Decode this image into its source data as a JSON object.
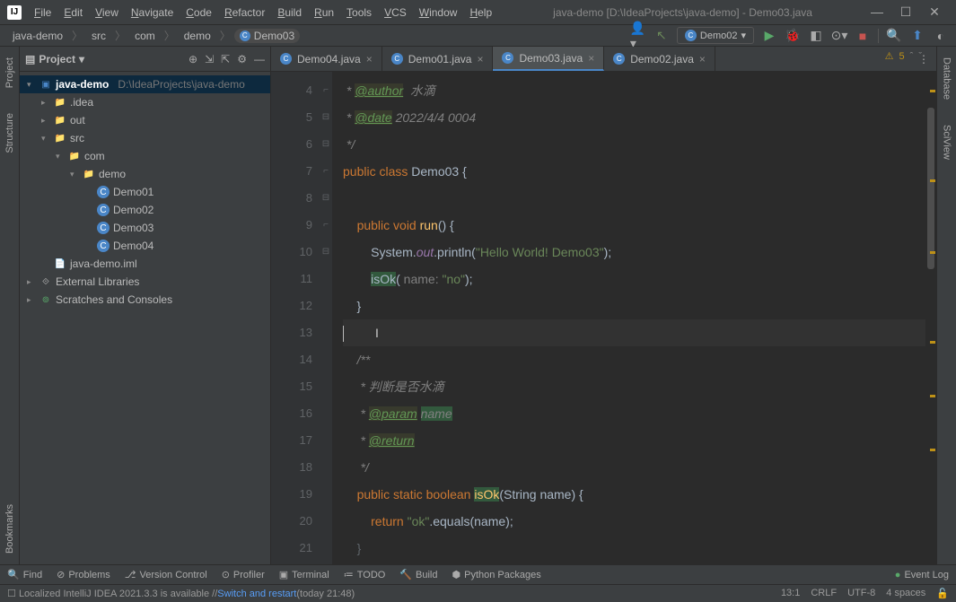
{
  "title": "java-demo [D:\\IdeaProjects\\java-demo] - Demo03.java",
  "menu": [
    "File",
    "Edit",
    "View",
    "Navigate",
    "Code",
    "Refactor",
    "Build",
    "Run",
    "Tools",
    "VCS",
    "Window",
    "Help"
  ],
  "breadcrumb": [
    "java-demo",
    "src",
    "com",
    "demo",
    "Demo03"
  ],
  "runConfig": "Demo02",
  "projectPanel": {
    "title": "Project"
  },
  "tree": {
    "root": {
      "name": "java-demo",
      "path": "D:\\IdeaProjects\\java-demo"
    },
    "idea": ".idea",
    "out": "out",
    "src": "src",
    "com": "com",
    "demo": "demo",
    "classes": [
      "Demo01",
      "Demo02",
      "Demo03",
      "Demo04"
    ],
    "iml": "java-demo.iml",
    "ext": "External Libraries",
    "scratch": "Scratches and Consoles"
  },
  "tabs": [
    {
      "name": "Demo04.java",
      "active": false
    },
    {
      "name": "Demo01.java",
      "active": false
    },
    {
      "name": "Demo03.java",
      "active": true
    },
    {
      "name": "Demo02.java",
      "active": false
    }
  ],
  "inspection": {
    "warnings": "5"
  },
  "code": {
    "lineStart": 4,
    "lines": [
      {
        "n": 4,
        "html": "<span class='comment'> * </span><span class='doctag'>@author</span><span class='comment'>  水滴</span>"
      },
      {
        "n": 5,
        "html": "<span class='comment'> * </span><span class='doctag'>@date</span><span class='comment'> 2022/4/4 0004</span>"
      },
      {
        "n": 6,
        "html": "<span class='comment'> */</span>",
        "fold": "e"
      },
      {
        "n": 7,
        "html": "<span class='kw'>public class </span><span class='cls'>Demo03</span> {",
        "fold": "s"
      },
      {
        "n": 8,
        "html": ""
      },
      {
        "n": 9,
        "html": "    <span class='kw'>public void </span><span class='method'>run</span>() {",
        "fold": "s"
      },
      {
        "n": 10,
        "html": "        System.<span class='field'>out</span>.println(<span class='str'>\"Hello World! Demo03\"</span>);"
      },
      {
        "n": 11,
        "html": "        <span class='hl'>isOk</span>(<span class='param'> name: </span><span class='str'>\"no\"</span>);"
      },
      {
        "n": 12,
        "html": "    }",
        "fold": "e"
      },
      {
        "n": 13,
        "html": "<span class='caret'></span>         <span style='color:#ccc'>I</span>",
        "current": true
      },
      {
        "n": 14,
        "html": "    <span class='comment'>/**</span>",
        "fold": "s"
      },
      {
        "n": 15,
        "html": "    <span class='comment'> * 判断是否水滴</span>"
      },
      {
        "n": 16,
        "html": "    <span class='comment'> * </span><span class='doctag'>@param</span> <span class='hl param' style='font-style:italic'>name</span>"
      },
      {
        "n": 17,
        "html": "    <span class='comment'> * </span><span class='doctag'>@return</span>"
      },
      {
        "n": 18,
        "html": "    <span class='comment'> */</span>",
        "fold": "e"
      },
      {
        "n": 19,
        "html": "    <span class='kw'>public static boolean </span><span class='hl method'>isOk</span>(String name) {",
        "fold": "s"
      },
      {
        "n": 20,
        "html": "        <span class='kw'>return </span><span class='str'>\"ok\"</span>.equals(name);"
      },
      {
        "n": 21,
        "html": "    <span style='opacity:.4'>}</span>"
      }
    ]
  },
  "bottomTools": [
    "Find",
    "Problems",
    "Version Control",
    "Profiler",
    "Terminal",
    "TODO",
    "Build",
    "Python Packages"
  ],
  "eventLog": "Event Log",
  "status": {
    "msg": "Localized IntelliJ IDEA 2021.3.3 is available // ",
    "link": "Switch and restart",
    "time": " (today 21:48)",
    "pos": "13:1",
    "sep": "CRLF",
    "enc": "UTF-8",
    "indent": "4 spaces"
  },
  "leftTabs": [
    "Project",
    "Structure"
  ],
  "leftBottom": "Bookmarks",
  "rightTabs": [
    "Database",
    "SciView"
  ]
}
